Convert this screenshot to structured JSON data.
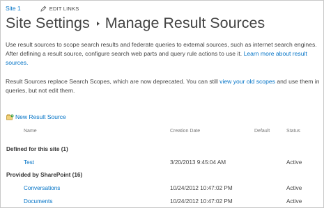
{
  "breadcrumb": {
    "site_link": "Site 1",
    "edit_links": "EDIT LINKS"
  },
  "title": {
    "parent": "Site Settings",
    "current": "Manage Result Sources"
  },
  "description": {
    "p1_text": "Use result sources to scope search results and federate queries to external sources, such as internet search engines. After defining a result source, configure search web parts and query rule actions to use it. ",
    "p1_link": "Learn more about result sources.",
    "p2_text_before": "Result Sources replace Search Scopes, which are now deprecated. You can still ",
    "p2_link": "view your old scopes",
    "p2_text_after": " and use them in queries, but not edit them."
  },
  "toolbar": {
    "new_result_source": "New Result Source"
  },
  "table": {
    "columns": {
      "name": "Name",
      "creation_date": "Creation Date",
      "default": "Default",
      "status": "Status"
    },
    "groups": [
      {
        "label": "Defined for this site (1)",
        "rows": [
          {
            "name": "Test",
            "creation_date": "3/20/2013 9:45:04 AM",
            "default": "",
            "status": "Active"
          }
        ]
      },
      {
        "label": "Provided by SharePoint (16)",
        "rows": [
          {
            "name": "Conversations",
            "creation_date": "10/24/2012 10:47:02 PM",
            "default": "",
            "status": "Active"
          },
          {
            "name": "Documents",
            "creation_date": "10/24/2012 10:47:02 PM",
            "default": "",
            "status": "Active"
          }
        ]
      }
    ]
  }
}
